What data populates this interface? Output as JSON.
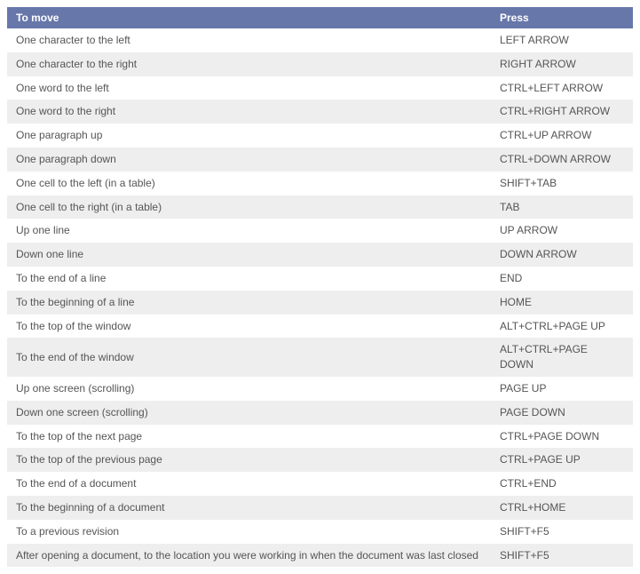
{
  "table": {
    "headers": {
      "col1": "To move",
      "col2": "Press"
    },
    "rows": [
      {
        "move": "One character to the left",
        "press": "LEFT ARROW"
      },
      {
        "move": "One character to the right",
        "press": "RIGHT ARROW"
      },
      {
        "move": "One word to the left",
        "press": "CTRL+LEFT ARROW"
      },
      {
        "move": "One word to the right",
        "press": "CTRL+RIGHT ARROW"
      },
      {
        "move": "One paragraph up",
        "press": "CTRL+UP ARROW"
      },
      {
        "move": "One paragraph down",
        "press": "CTRL+DOWN ARROW"
      },
      {
        "move": "One cell to the left (in a table)",
        "press": "SHIFT+TAB"
      },
      {
        "move": "One cell to the right (in a table)",
        "press": "TAB"
      },
      {
        "move": "Up one line",
        "press": "UP ARROW"
      },
      {
        "move": "Down one line",
        "press": "DOWN ARROW"
      },
      {
        "move": "To the end of a line",
        "press": "END"
      },
      {
        "move": "To the beginning of a line",
        "press": "HOME"
      },
      {
        "move": "To the top of the window",
        "press": "ALT+CTRL+PAGE UP"
      },
      {
        "move": "To the end of the window",
        "press": "ALT+CTRL+PAGE DOWN"
      },
      {
        "move": "Up one screen (scrolling)",
        "press": "PAGE UP"
      },
      {
        "move": "Down one screen (scrolling)",
        "press": "PAGE DOWN"
      },
      {
        "move": "To the top of the next page",
        "press": "CTRL+PAGE DOWN"
      },
      {
        "move": "To the top of the previous page",
        "press": "CTRL+PAGE UP"
      },
      {
        "move": "To the end of a document",
        "press": "CTRL+END"
      },
      {
        "move": "To the beginning of a document",
        "press": "CTRL+HOME"
      },
      {
        "move": "To a previous revision",
        "press": "SHIFT+F5"
      },
      {
        "move": "After opening a document, to the location you were working in when the document was last closed",
        "press": "SHIFT+F5"
      }
    ]
  }
}
